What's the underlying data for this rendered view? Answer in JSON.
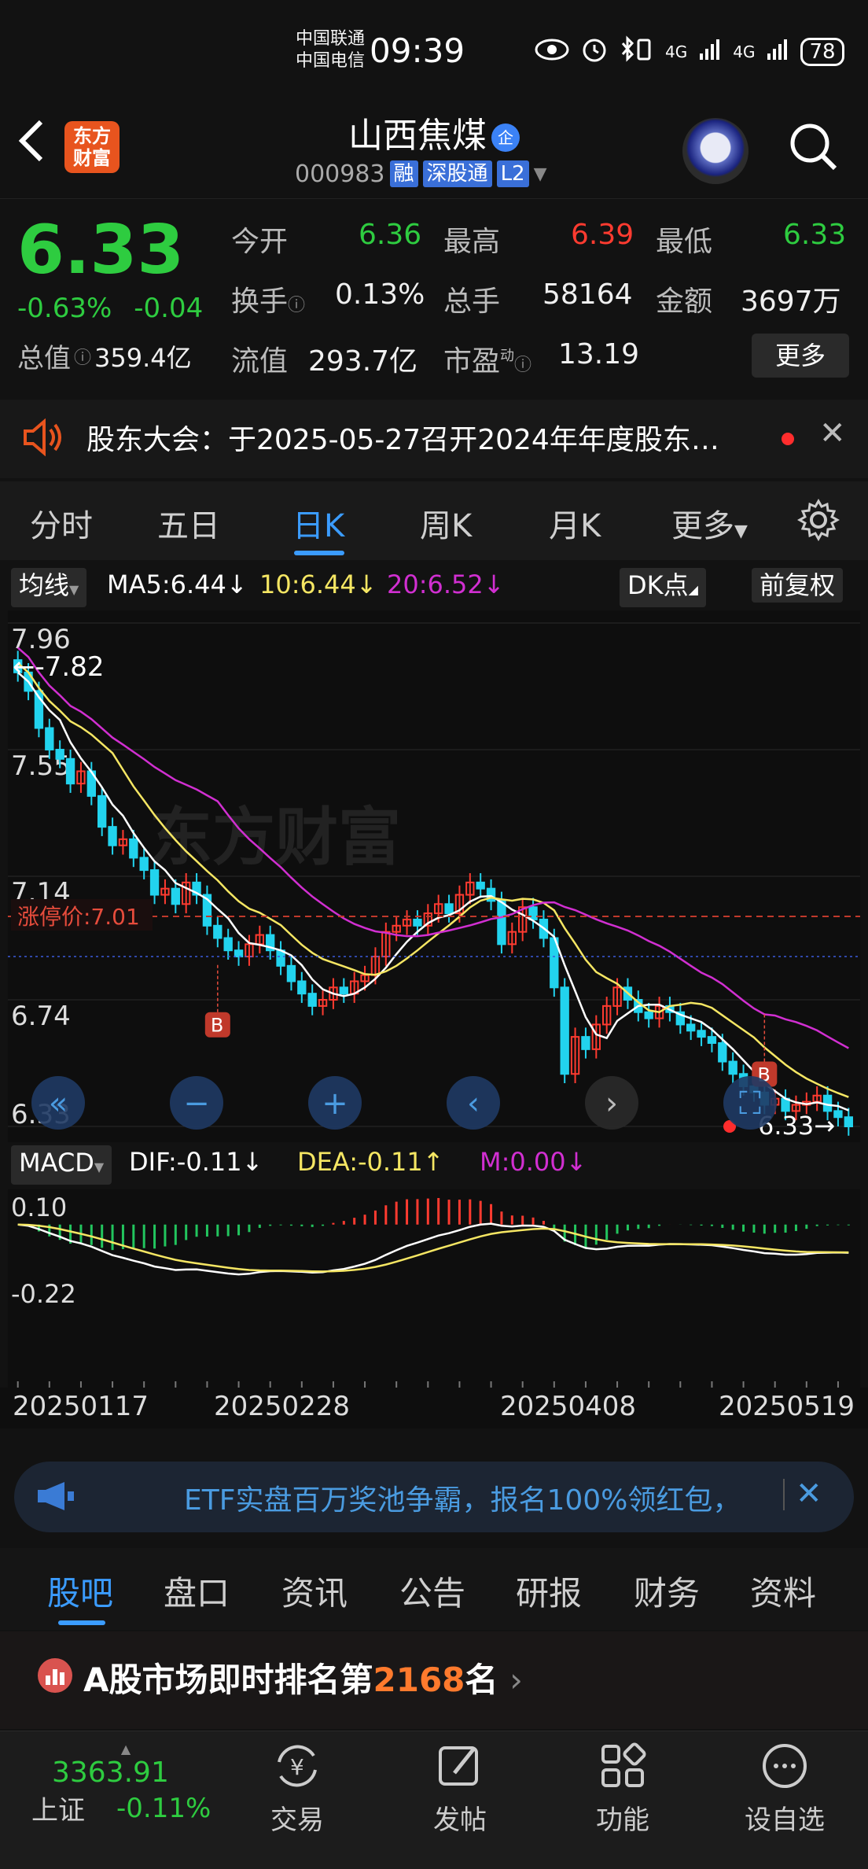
{
  "status_bar": {
    "carrier1": "中国联通",
    "carrier2": "中国电信",
    "time": "09:39",
    "signal1": "4G",
    "signal2": "4G",
    "battery": "78"
  },
  "header": {
    "logo_line1": "东方",
    "logo_line2": "财富",
    "name": "山西焦煤",
    "name_badge": "企",
    "code": "000983",
    "tags": [
      "融",
      "深股通",
      "L2"
    ]
  },
  "quote": {
    "price": "6.33",
    "change_pct": "-0.63%",
    "change": "-0.04",
    "total_value_label": "总值",
    "total_value": "359.4亿",
    "open_label": "今开",
    "open": "6.36",
    "high_label": "最高",
    "high": "6.39",
    "low_label": "最低",
    "low": "6.33",
    "turnover_label": "换手",
    "turnover": "0.13%",
    "volume_label": "总手",
    "volume": "58164",
    "amount_label": "金额",
    "amount": "3697万",
    "float_label": "流值",
    "float_value": "293.7亿",
    "pe_label": "市盈",
    "pe_sup": "动",
    "pe": "13.19",
    "more": "更多"
  },
  "notice": {
    "text": "股东大会：于2025-05-27召开2024年年度股东…"
  },
  "period_tabs": [
    "分时",
    "五日",
    "日K",
    "周K",
    "月K",
    "更多"
  ],
  "active_period": 2,
  "ma_bar": {
    "selector": "均线",
    "ma5": "MA5:6.44",
    "ma10": "10:6.44",
    "ma20": "20:6.52",
    "dk": "DK点",
    "adjust": "前复权"
  },
  "colors": {
    "up": "#ff3b30",
    "down": "#22d3ee",
    "ma5": "#ffffff",
    "ma10": "#f5e663",
    "ma20": "#d12fd1",
    "accent": "#3b9cff"
  },
  "chart_data": [
    {
      "type": "candlestick",
      "y_ticks": [
        "7.96",
        "7.55",
        "7.14",
        "6.74",
        "6.33"
      ],
      "ylim": [
        6.33,
        7.96
      ],
      "annotations": {
        "high_marker": "←-7.82",
        "limit_up_label": "涨停价:7.01",
        "limit_up_value": 7.01,
        "last_marker": "6.33→",
        "buy_signal": "B"
      },
      "close": [
        7.8,
        7.74,
        7.62,
        7.55,
        7.52,
        7.44,
        7.48,
        7.4,
        7.3,
        7.24,
        7.26,
        7.2,
        7.16,
        7.08,
        7.1,
        7.05,
        7.12,
        7.08,
        6.98,
        6.94,
        6.9,
        6.88,
        6.92,
        6.95,
        6.9,
        6.85,
        6.8,
        6.76,
        6.72,
        6.74,
        6.78,
        6.76,
        6.8,
        6.82,
        6.88,
        6.96,
        6.98,
        7.0,
        6.98,
        7.02,
        7.05,
        7.02,
        7.08,
        7.12,
        7.1,
        7.06,
        6.92,
        6.96,
        7.04,
        7.0,
        6.94,
        6.78,
        6.5,
        6.62,
        6.58,
        6.66,
        6.72,
        6.78,
        6.74,
        6.7,
        6.68,
        6.72,
        6.7,
        6.66,
        6.64,
        6.62,
        6.6,
        6.54,
        6.5,
        6.46,
        6.44,
        6.4,
        6.42,
        6.38,
        6.4,
        6.41,
        6.43,
        6.38,
        6.36,
        6.33
      ]
    },
    {
      "type": "line",
      "name": "MACD",
      "header": {
        "selector": "MACD",
        "dif": "DIF:-0.11",
        "dea": "DEA:-0.11",
        "m": "M:0.00"
      },
      "y_ticks": [
        "0.10",
        "-0.22"
      ],
      "ylim": [
        -0.22,
        0.1
      ],
      "x_labels": [
        "20250117",
        "20250228",
        "20250408",
        "20250519"
      ]
    }
  ],
  "banner": {
    "text": "ETF实盘百万奖池争霸，报名100%领红包，"
  },
  "sub_tabs": [
    "股吧",
    "盘口",
    "资讯",
    "公告",
    "研报",
    "财务",
    "资料"
  ],
  "rank": {
    "prefix": "A股市场即时排名第",
    "num": "2168",
    "suffix": "名"
  },
  "bottom_nav": {
    "index_value": "3363.91",
    "index_name": "上证",
    "index_change": "-0.11%",
    "items": [
      "交易",
      "发帖",
      "功能",
      "设自选"
    ]
  }
}
